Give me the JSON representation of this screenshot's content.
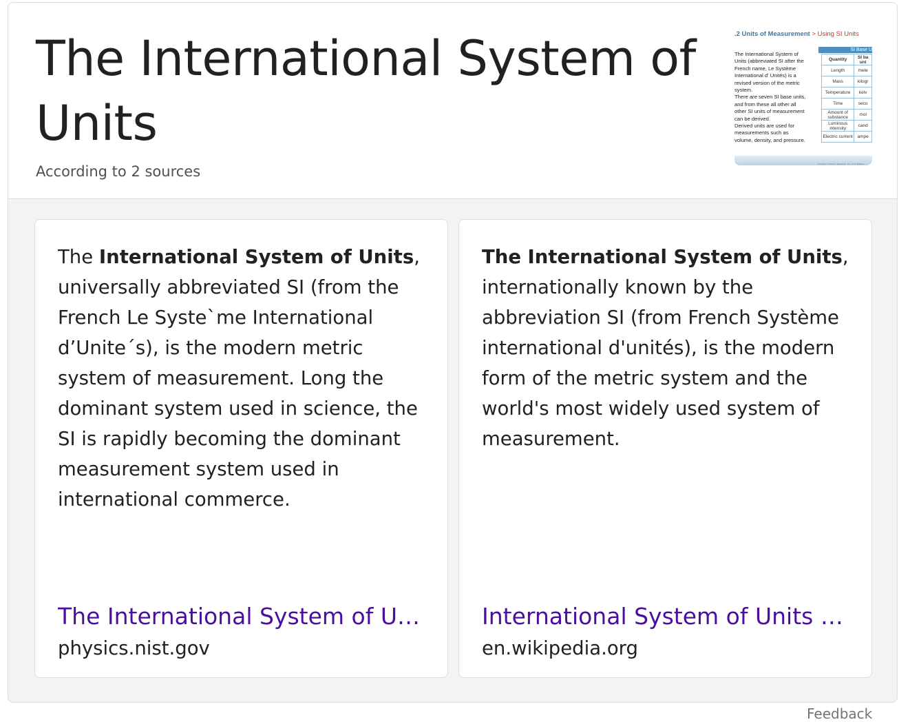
{
  "header": {
    "title": "The International System of Units",
    "subtitle": "According to 2 sources"
  },
  "thumbnail": {
    "breadcrumb_section": ".2 Units of Measurement",
    "breadcrumb_separator": ">",
    "breadcrumb_page": "Using SI Units",
    "table_title": "SI Base U",
    "text_lines": [
      "The International System of",
      "Units (abbreviated SI after the",
      "French name, Le Système",
      "International d' Unités) is a",
      "revised version of the metric",
      "system.",
      "There are seven SI base units,",
      "and from these all other all",
      "other SI units of measurement",
      "can be derived.",
      "Derived units are used for",
      "measurements such as",
      "volume, density, and pressure."
    ],
    "table_header": [
      "Quantity",
      "SI ba uni"
    ],
    "table_rows": [
      [
        "Length",
        "mete"
      ],
      [
        "Mass",
        "kilogr"
      ],
      [
        "Temperature",
        "kelv"
      ],
      [
        "Time",
        "seco"
      ],
      [
        "Amount of substance",
        "mol"
      ],
      [
        "Luminous intensity",
        "cand"
      ],
      [
        "Electric current",
        "ampe"
      ]
    ],
    "copyright": "Copyright © Pearson Education, Inc., or its affiliates."
  },
  "sources": [
    {
      "snippet_prefix": "The ",
      "snippet_bold": "International System of Units",
      "snippet_rest": ", universally abbreviated SI (from the French Le Syste`me International d’Unite´s), is the modern metric system of measurement. Long the dominant system used in science, the SI is rapidly becoming the dominant measurement system used in international commerce.",
      "link_title": "The International System of Units",
      "domain": "physics.nist.gov"
    },
    {
      "snippet_prefix": "",
      "snippet_bold": "The International System of Units",
      "snippet_rest": ", internationally known by the abbreviation SI (from French Système international d'unités), is the modern form of the metric system and the world's most widely used system of measurement.",
      "link_title": "International System of Units - Wikipedia",
      "domain": "en.wikipedia.org"
    }
  ],
  "footer": {
    "feedback_label": "Feedback"
  }
}
